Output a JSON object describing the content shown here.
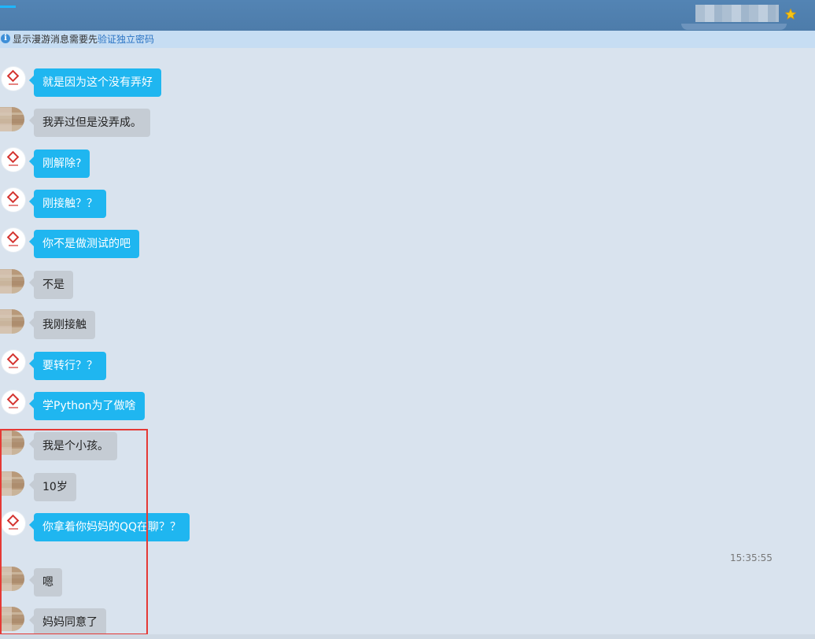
{
  "notice": {
    "prefix": "显示漫游消息需要先",
    "link": "验证独立密码"
  },
  "messages": [
    {
      "from": "them",
      "text": "就是因为这个没有弄好"
    },
    {
      "from": "me",
      "text": "我弄过但是没弄成。"
    },
    {
      "from": "them",
      "text": "刚解除?"
    },
    {
      "from": "them",
      "text": "刚接触？？"
    },
    {
      "from": "them",
      "text": "你不是做测试的吧"
    },
    {
      "from": "me",
      "text": "不是"
    },
    {
      "from": "me",
      "text": "我刚接触"
    },
    {
      "from": "them",
      "text": "要转行？？"
    },
    {
      "from": "them",
      "text": "学Python为了做啥"
    },
    {
      "from": "me",
      "text": "我是个小孩。"
    },
    {
      "from": "me",
      "text": "10岁"
    },
    {
      "from": "them",
      "text": "你拿着你妈妈的QQ在聊？？"
    },
    {
      "from": "me",
      "text": "嗯"
    },
    {
      "from": "me",
      "text": "妈妈同意了"
    }
  ],
  "timestamp": "15:35:55",
  "icons": {
    "info": "info-icon",
    "star": "star-icon"
  },
  "colors": {
    "titlebar": "#4d7caa",
    "bubble_them": "#1fb6f0",
    "bubble_me": "#c5ccd4",
    "highlight": "#e53935"
  }
}
